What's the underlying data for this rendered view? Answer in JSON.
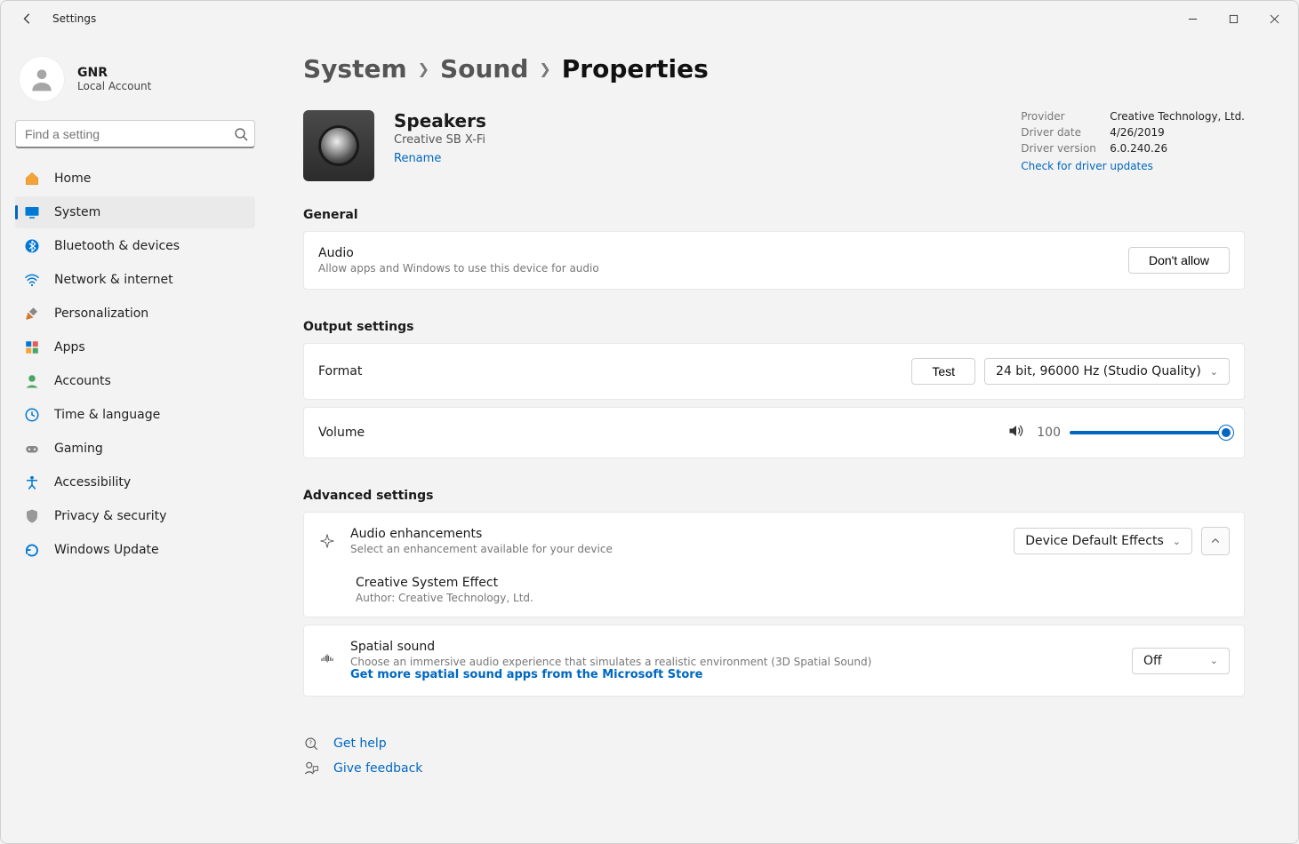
{
  "window": {
    "title": "Settings"
  },
  "user": {
    "name": "GNR",
    "sub": "Local Account"
  },
  "search": {
    "placeholder": "Find a setting"
  },
  "sidebar": {
    "items": [
      {
        "label": "Home"
      },
      {
        "label": "System"
      },
      {
        "label": "Bluetooth & devices"
      },
      {
        "label": "Network & internet"
      },
      {
        "label": "Personalization"
      },
      {
        "label": "Apps"
      },
      {
        "label": "Accounts"
      },
      {
        "label": "Time & language"
      },
      {
        "label": "Gaming"
      },
      {
        "label": "Accessibility"
      },
      {
        "label": "Privacy & security"
      },
      {
        "label": "Windows Update"
      }
    ]
  },
  "breadcrumb": {
    "a": "System",
    "b": "Sound",
    "c": "Properties"
  },
  "device": {
    "name": "Speakers",
    "sub": "Creative SB X-Fi",
    "rename": "Rename"
  },
  "driver": {
    "provider_label": "Provider",
    "provider": "Creative Technology, Ltd.",
    "date_label": "Driver date",
    "date": "4/26/2019",
    "version_label": "Driver version",
    "version": "6.0.240.26",
    "check": "Check for driver updates"
  },
  "general": {
    "title": "General",
    "audio": {
      "title": "Audio",
      "sub": "Allow apps and Windows to use this device for audio",
      "button": "Don't allow"
    }
  },
  "output": {
    "title": "Output settings",
    "format": {
      "label": "Format",
      "test": "Test",
      "value": "24 bit, 96000 Hz (Studio Quality)"
    },
    "volume": {
      "label": "Volume",
      "value": "100"
    }
  },
  "advanced": {
    "title": "Advanced settings",
    "enhance": {
      "title": "Audio enhancements",
      "sub": "Select an enhancement available for your device",
      "value": "Device Default Effects"
    },
    "effect": {
      "title": "Creative System Effect",
      "sub": "Author: Creative Technology, Ltd."
    },
    "spatial": {
      "title": "Spatial sound",
      "sub": "Choose an immersive audio experience that simulates a realistic environment (3D Spatial Sound)",
      "link": "Get more spatial sound apps from the Microsoft Store",
      "value": "Off"
    }
  },
  "footer": {
    "help": "Get help",
    "feedback": "Give feedback"
  }
}
